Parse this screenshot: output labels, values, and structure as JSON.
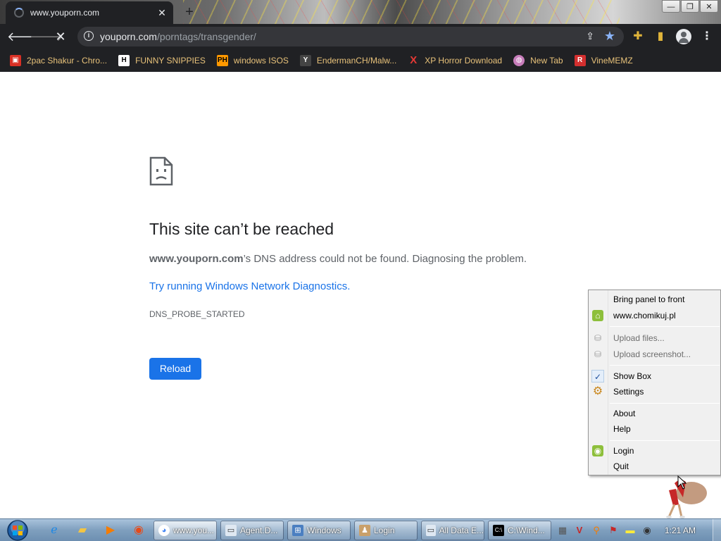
{
  "browser": {
    "tab_title": "www.youporn.com",
    "new_tab": "+",
    "url_domain": "youporn.com",
    "url_path": "/porntags/transgender/",
    "bookmarks": [
      {
        "label": "2pac Shakur - Chro...",
        "icon": "tupac-icon",
        "color": "#d93025"
      },
      {
        "label": "FUNNY SNIPPIES",
        "icon": "h-icon",
        "color": "#ffffff"
      },
      {
        "label": "windows ISOS",
        "icon": "ph-icon",
        "color": "#ff9900"
      },
      {
        "label": "EndermanCH/Malw...",
        "icon": "yp-icon",
        "color": "#444444"
      },
      {
        "label": "XP Horror Download",
        "icon": "x-icon",
        "color": "#e53935"
      },
      {
        "label": "New Tab",
        "icon": "globe-icon",
        "color": "#c77dbb"
      },
      {
        "label": "VineMEMZ",
        "icon": "r-icon",
        "color": "#d32f2f"
      }
    ]
  },
  "error": {
    "title": "This site can’t be reached",
    "host": "www.youporn.com",
    "desc_rest": "’s DNS address could not be found. Diagnosing the problem.",
    "link": "Try running Windows Network Diagnostics.",
    "code": "DNS_PROBE_STARTED",
    "reload": "Reload"
  },
  "context_menu": {
    "items": [
      {
        "label": "Bring panel to front",
        "icon": "",
        "disabled": false
      },
      {
        "label": "www.chomikuj.pl",
        "icon": "home-icon",
        "disabled": false
      },
      {
        "label": "Upload files...",
        "icon": "upload-icon",
        "disabled": true
      },
      {
        "label": "Upload screenshot...",
        "icon": "screenshot-icon",
        "disabled": true
      },
      {
        "label": "Show Box",
        "icon": "checkmark-icon",
        "disabled": false
      },
      {
        "label": "Settings",
        "icon": "settings-icon",
        "disabled": false
      },
      {
        "label": "About",
        "icon": "",
        "disabled": false
      },
      {
        "label": "Help",
        "icon": "",
        "disabled": false
      },
      {
        "label": "Login",
        "icon": "login-icon",
        "disabled": false
      },
      {
        "label": "Quit",
        "icon": "",
        "disabled": false
      }
    ]
  },
  "taskbar": {
    "buttons": [
      {
        "label": "www.you...",
        "active": true
      },
      {
        "label": "Agent.D...",
        "active": false
      },
      {
        "label": "Windows",
        "active": false
      },
      {
        "label": "Login",
        "active": false
      },
      {
        "label": "All Data E...",
        "active": false
      },
      {
        "label": "C:\\Wind...",
        "active": false
      }
    ],
    "clock": "1:21 AM"
  }
}
